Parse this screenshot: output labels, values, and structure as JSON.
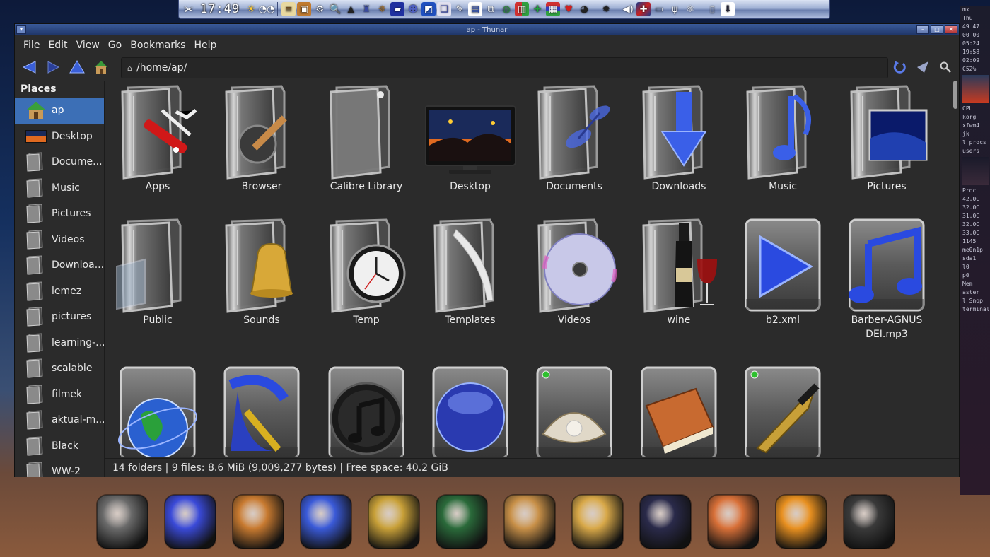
{
  "top_panel": {
    "time": "17:49",
    "icons": [
      "tools-icon",
      "sun-icon",
      "eyes-icon",
      "notes-icon",
      "box-icon",
      "gear-icon",
      "search-doc-icon",
      "hat-icon",
      "wizard-icon",
      "compass-icon",
      "flag-icon",
      "user-icon",
      "app-icon",
      "files-icon",
      "pen-icon",
      "window-icon",
      "network-icon",
      "globe-icon",
      "chart-icon",
      "cross-icon",
      "cards-icon",
      "heart-icon",
      "gauge-icon",
      "bug-icon",
      "volume-icon",
      "uk-flag-icon",
      "monitor-icon",
      "antenna-icon",
      "settings-icon",
      "trash-icon",
      "download-icon"
    ]
  },
  "window": {
    "title": "ap - Thunar",
    "menu": [
      "File",
      "Edit",
      "View",
      "Go",
      "Bookmarks",
      "Help"
    ],
    "location": "/home/ap/"
  },
  "sidebar": {
    "heading": "Places",
    "items": [
      {
        "label": "ap",
        "icon": "home-icon",
        "active": true
      },
      {
        "label": "Desktop",
        "icon": "desktop-icon"
      },
      {
        "label": "Docume...",
        "icon": "documents-folder-icon"
      },
      {
        "label": "Music",
        "icon": "music-folder-icon"
      },
      {
        "label": "Pictures",
        "icon": "pictures-folder-icon"
      },
      {
        "label": "Videos",
        "icon": "videos-folder-icon"
      },
      {
        "label": "Downloa...",
        "icon": "downloads-folder-icon"
      },
      {
        "label": "lemez",
        "icon": "folder-icon"
      },
      {
        "label": "pictures",
        "icon": "folder-icon"
      },
      {
        "label": "learning-...",
        "icon": "folder-icon"
      },
      {
        "label": "scalable",
        "icon": "folder-icon"
      },
      {
        "label": "filmek",
        "icon": "folder-icon"
      },
      {
        "label": "aktual-m...",
        "icon": "folder-icon"
      },
      {
        "label": "Black",
        "icon": "folder-icon"
      },
      {
        "label": "WW-2",
        "icon": "folder-icon"
      }
    ]
  },
  "files": [
    {
      "label": "Apps",
      "icon": "apps-folder-icon"
    },
    {
      "label": "Browser",
      "icon": "browser-folder-icon"
    },
    {
      "label": "Calibre Library",
      "icon": "calibre-folder-icon"
    },
    {
      "label": "Desktop",
      "icon": "desktop-monitor-icon"
    },
    {
      "label": "Documents",
      "icon": "documents-folder-icon"
    },
    {
      "label": "Downloads",
      "icon": "downloads-folder-icon"
    },
    {
      "label": "Music",
      "icon": "music-folder-icon"
    },
    {
      "label": "Pictures",
      "icon": "pictures-folder-icon"
    },
    {
      "label": "Public",
      "icon": "public-folder-icon"
    },
    {
      "label": "Sounds",
      "icon": "sounds-folder-icon"
    },
    {
      "label": "Temp",
      "icon": "temp-folder-icon"
    },
    {
      "label": "Templates",
      "icon": "templates-folder-icon"
    },
    {
      "label": "Videos",
      "icon": "videos-folder-icon"
    },
    {
      "label": "wine",
      "icon": "wine-folder-icon"
    },
    {
      "label": "b2.xml",
      "icon": "xml-file-icon"
    },
    {
      "label": "Barber-AGNUS DEI.mp3",
      "icon": "mp3-file-icon"
    },
    {
      "label": "",
      "icon": "globe-file-icon"
    },
    {
      "label": "",
      "icon": "paint-file-icon"
    },
    {
      "label": "",
      "icon": "itunes-file-icon"
    },
    {
      "label": "",
      "icon": "sphere-file-icon"
    },
    {
      "label": "",
      "icon": "oyster-file-icon"
    },
    {
      "label": "",
      "icon": "book-file-icon"
    },
    {
      "label": "",
      "icon": "pen-file-icon"
    }
  ],
  "statusbar": {
    "text": "14 folders  |  9 files: 8.6 MiB (9,009,277 bytes)  |  Free space: 40.2 GiB"
  },
  "conky": {
    "lines": [
      "mx",
      "Thu",
      "49 47",
      "00 00",
      "05:24",
      "19:58",
      "02:09",
      "C52%",
      "CPU",
      "korg",
      "xfwm4",
      "jk",
      "l procs",
      "users",
      "Proc",
      "42.0C",
      "32.0C",
      "31.0C",
      "32.0C",
      "33.0C",
      "1145",
      "me0n1p",
      "sda1",
      "l0",
      "p0",
      "Mem",
      "aster",
      "l Snop",
      "terminal"
    ]
  },
  "dock": {
    "items": [
      "helmet-app-icon",
      "paint-app-icon",
      "diving-helmet-app-icon",
      "folder-app-icon",
      "sextant-app-icon",
      "notebook-app-icon",
      "crate-app-icon",
      "lion-app-icon",
      "user-terminal-app-icon",
      "fox-app-icon",
      "orange-app-icon",
      "camera-app-icon"
    ]
  }
}
